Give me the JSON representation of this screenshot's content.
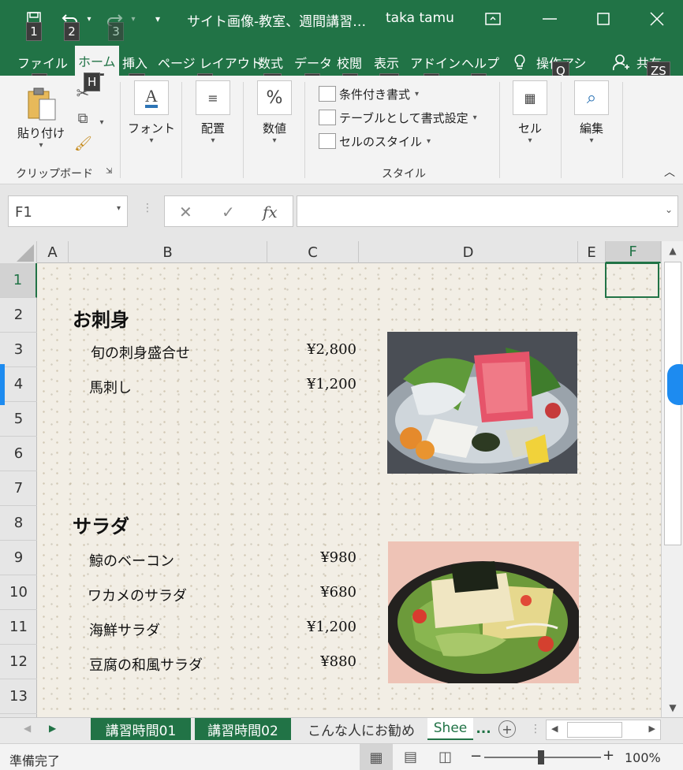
{
  "titlebar": {
    "title": "サイト画像-教室、週間講習…",
    "user": "taka tamu",
    "keytips": [
      "1",
      "2",
      "3"
    ]
  },
  "tabs": [
    {
      "label": "ファイル",
      "key": "F"
    },
    {
      "label": "ホーム",
      "key": "H"
    },
    {
      "label": "挿入",
      "key": "N"
    },
    {
      "label": "ページ レイアウト",
      "key": "P"
    },
    {
      "label": "数式",
      "key": "M"
    },
    {
      "label": "データ",
      "key": "A"
    },
    {
      "label": "校閲",
      "key": "R"
    },
    {
      "label": "表示",
      "key": "W"
    },
    {
      "label": "アドイン",
      "key": "X"
    },
    {
      "label": "ヘルプ",
      "key": "Y"
    },
    {
      "label": "操作アシ",
      "key": "Q"
    },
    {
      "label": "共有",
      "key": "ZS"
    }
  ],
  "ribbon": {
    "paste": "貼り付け",
    "clipboard": "クリップボード",
    "font": "フォント",
    "alignment": "配置",
    "number": "数値",
    "conditional": "条件付き書式",
    "table_format": "テーブルとして書式設定",
    "cell_styles": "セルのスタイル",
    "styles": "スタイル",
    "cells": "セル",
    "editing": "編集"
  },
  "formula": {
    "namebox": "F1",
    "fx": "fx",
    "value": ""
  },
  "columns": [
    "A",
    "B",
    "C",
    "D",
    "E",
    "F"
  ],
  "rows": [
    "1",
    "2",
    "3",
    "4",
    "5",
    "6",
    "7",
    "8",
    "9",
    "10",
    "11",
    "12",
    "13"
  ],
  "menu": {
    "sashimi_heading": "お刺身",
    "sashimi_items": [
      {
        "name": "旬の刺身盛合せ",
        "price": "¥2,800"
      },
      {
        "name": "馬刺し",
        "price": "¥1,200"
      }
    ],
    "salad_heading": "サラダ",
    "salad_items": [
      {
        "name": "鯨のベーコン",
        "price": "¥980"
      },
      {
        "name": "ワカメのサラダ",
        "price": "¥680"
      },
      {
        "name": "海鮮サラダ",
        "price": "¥1,200"
      },
      {
        "name": "豆腐の和風サラダ",
        "price": "¥880"
      }
    ]
  },
  "sheets": [
    "講習時間01",
    "講習時間02",
    "こんな人にお勧め",
    "Shee"
  ],
  "sheet_more": "...",
  "status": {
    "ready": "準備完了",
    "zoom": "100%"
  },
  "colors": {
    "excel_green": "#217346",
    "paper": "#f2eee5"
  }
}
